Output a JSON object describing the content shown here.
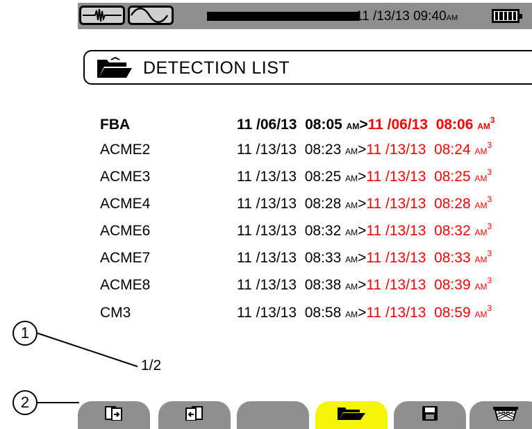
{
  "status_bar": {
    "date": "11 /13/13",
    "time": "09:40",
    "meridiem": "AM",
    "icons": [
      "transient-waveform-icon",
      "sine-waveform-icon",
      "battery-full-icon"
    ]
  },
  "header": {
    "title": "DETECTION LIST",
    "icon": "open-folder-icon"
  },
  "detections": [
    {
      "name": "FBA",
      "start_date": "11 /06/13",
      "start_time": "08:05",
      "start_ampm": "AM",
      "end_date": "11 /06/13",
      "end_time": "08:06",
      "end_ampm": "AM",
      "superscript": "3",
      "bold": true
    },
    {
      "name": "ACME2",
      "start_date": "11 /13/13",
      "start_time": "08:23",
      "start_ampm": "AM",
      "end_date": "11 /13/13",
      "end_time": "08:24",
      "end_ampm": "AM",
      "superscript": "3"
    },
    {
      "name": "ACME3",
      "start_date": "11 /13/13",
      "start_time": "08:25",
      "start_ampm": "AM",
      "end_date": "11 /13/13",
      "end_time": "08:25",
      "end_ampm": "AM",
      "superscript": "3"
    },
    {
      "name": "ACME4",
      "start_date": "11 /13/13",
      "start_time": "08:28",
      "start_ampm": "AM",
      "end_date": "11 /13/13",
      "end_time": "08:28",
      "end_ampm": "AM",
      "superscript": "3"
    },
    {
      "name": "ACME6",
      "start_date": "11 /13/13",
      "start_time": "08:32",
      "start_ampm": "AM",
      "end_date": "11 /13/13",
      "end_time": "08:32",
      "end_ampm": "AM",
      "superscript": "3"
    },
    {
      "name": "ACME7",
      "start_date": "11 /13/13",
      "start_time": "08:33",
      "start_ampm": "AM",
      "end_date": "11 /13/13",
      "end_time": "08:33",
      "end_ampm": "AM",
      "superscript": "3"
    },
    {
      "name": "ACME8",
      "start_date": "11 /13/13",
      "start_time": "08:38",
      "start_ampm": "AM",
      "end_date": "11 /13/13",
      "end_time": "08:39",
      "end_ampm": "AM",
      "superscript": "3"
    },
    {
      "name": "CM3",
      "start_date": "11 /13/13",
      "start_time": "08:58",
      "start_ampm": "AM",
      "end_date": "11 /13/13",
      "end_time": "08:59",
      "end_ampm": "AM",
      "superscript": "3"
    }
  ],
  "separator": ">",
  "pagination": "1/2",
  "callouts": [
    "1",
    "2"
  ],
  "function_keys": [
    {
      "icon": "page-forward-icon",
      "active": false
    },
    {
      "icon": "page-back-icon",
      "active": false
    },
    {
      "icon": "",
      "active": false
    },
    {
      "icon": "open-folder-icon",
      "active": true
    },
    {
      "icon": "floppy-disk-icon",
      "active": false
    },
    {
      "icon": "trash-bin-icon",
      "active": false
    }
  ],
  "colors": {
    "status_bar": "#8f8f8f",
    "function_key": "#8f8f8f",
    "function_key_active": "#f5f50a",
    "end_time": "#ff0000"
  }
}
